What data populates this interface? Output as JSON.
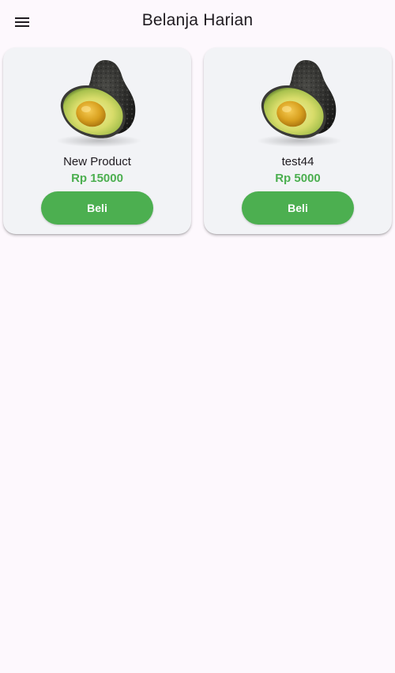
{
  "appbar": {
    "title": "Belanja Harian",
    "menu_icon": "menu-icon"
  },
  "products": [
    {
      "name": "New Product",
      "price": "Rp 15000",
      "button_label": "Beli",
      "image": "avocado"
    },
    {
      "name": "test44",
      "price": "Rp 5000",
      "button_label": "Beli",
      "image": "avocado"
    }
  ],
  "colors": {
    "background": "#fdf8fd",
    "card": "#f2f3f6",
    "accent": "#4caf50",
    "text": "#1f1b20"
  }
}
